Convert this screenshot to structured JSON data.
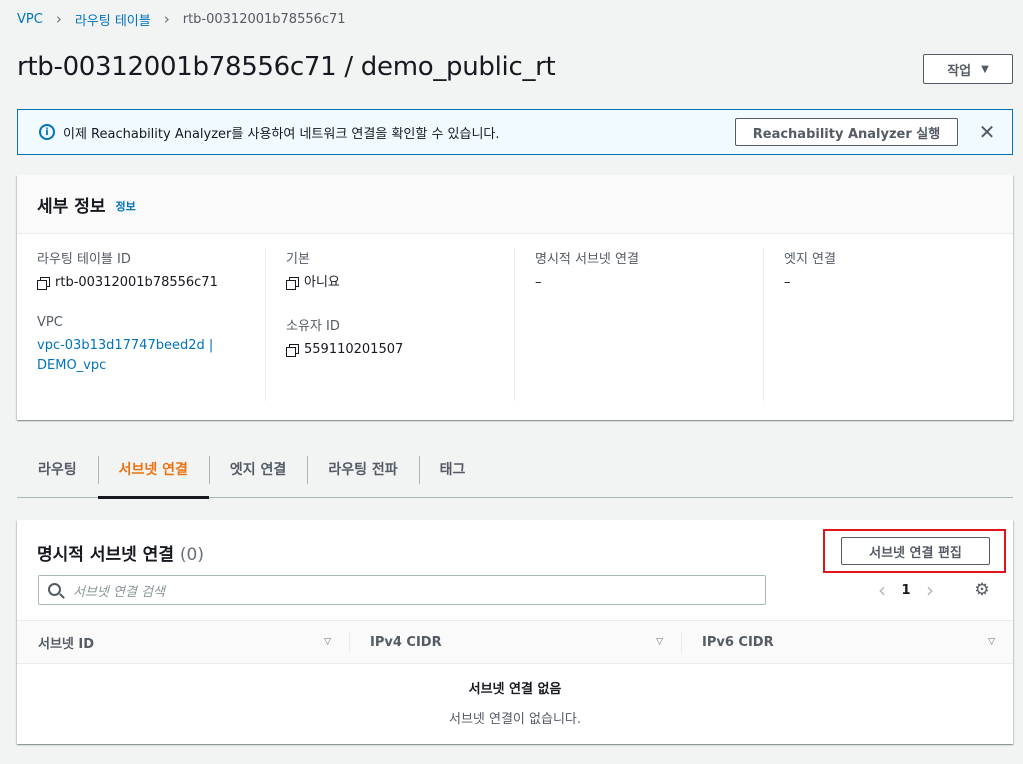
{
  "breadcrumb": {
    "items": [
      "VPC",
      "라우팅 테이블"
    ],
    "current": "rtb-00312001b78556c71"
  },
  "page": {
    "title": "rtb-00312001b78556c71 / demo_public_rt",
    "actions_label": "작업"
  },
  "flash": {
    "message": "이제 Reachability Analyzer를 사용하여 네트워크 연결을 확인할 수 있습니다.",
    "button_label": "Reachability Analyzer 실행"
  },
  "details": {
    "title": "세부 정보",
    "info_link": "정보",
    "fields": {
      "rt_id_label": "라우팅 테이블 ID",
      "rt_id_value": "rtb-00312001b78556c71",
      "vpc_label": "VPC",
      "vpc_value_line1": "vpc-03b13d17747beed2d |",
      "vpc_value_line2": "DEMO_vpc",
      "main_label": "기본",
      "main_value": "아니요",
      "owner_label": "소유자 ID",
      "owner_value": "559110201507",
      "explicit_label": "명시적 서브넷 연결",
      "explicit_value": "–",
      "edge_label": "엣지 연결",
      "edge_value": "–"
    }
  },
  "tabs": [
    {
      "label": "라우팅"
    },
    {
      "label": "서브넷 연결"
    },
    {
      "label": "엣지 연결"
    },
    {
      "label": "라우팅 전파"
    },
    {
      "label": "태그"
    }
  ],
  "assoc": {
    "title": "명시적 서브넷 연결",
    "count": "(0)",
    "edit_label": "서브넷 연결 편집",
    "search_placeholder": "서브넷 연결 검색",
    "page_number": "1",
    "columns": [
      "서브넷 ID",
      "IPv4 CIDR",
      "IPv6 CIDR"
    ],
    "empty_title": "서브넷 연결 없음",
    "empty_sub": "서브넷 연결이 없습니다."
  },
  "colors": {
    "accent": "#ec7211",
    "link": "#0073bb",
    "highlight": "#e0141a"
  }
}
